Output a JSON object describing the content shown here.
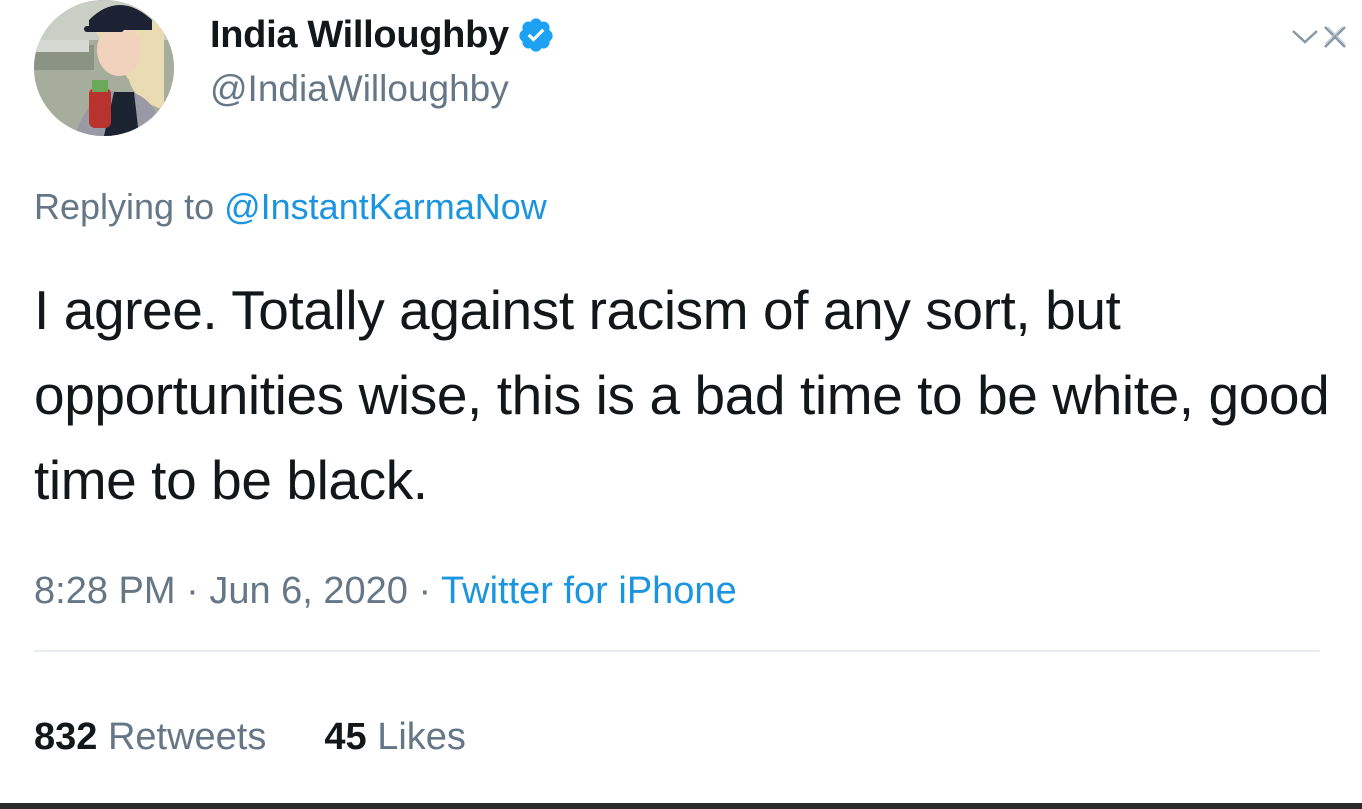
{
  "author": {
    "display_name": "India Willoughby",
    "handle": "@IndiaWilloughby",
    "verified": true
  },
  "reply": {
    "prefix": "Replying to ",
    "mention": "@InstantKarmaNow"
  },
  "tweet": {
    "text": "I agree. Totally against racism of any sort, but opportunities wise, this is a bad time to be white, good time to be black."
  },
  "meta": {
    "time": "8:28 PM",
    "separator": " · ",
    "date": "Jun 6, 2020",
    "source": "Twitter for iPhone"
  },
  "stats": {
    "retweets_count": "832",
    "retweets_label": " Retweets",
    "likes_count": "45",
    "likes_label": " Likes"
  },
  "icons": {
    "verified": "verified-badge-icon",
    "chevron": "chevron-down-icon",
    "close": "close-icon"
  },
  "colors": {
    "accent": "#1b95e0",
    "secondary_text": "#657786",
    "primary_text": "#14171a",
    "verified": "#1da1f2"
  }
}
